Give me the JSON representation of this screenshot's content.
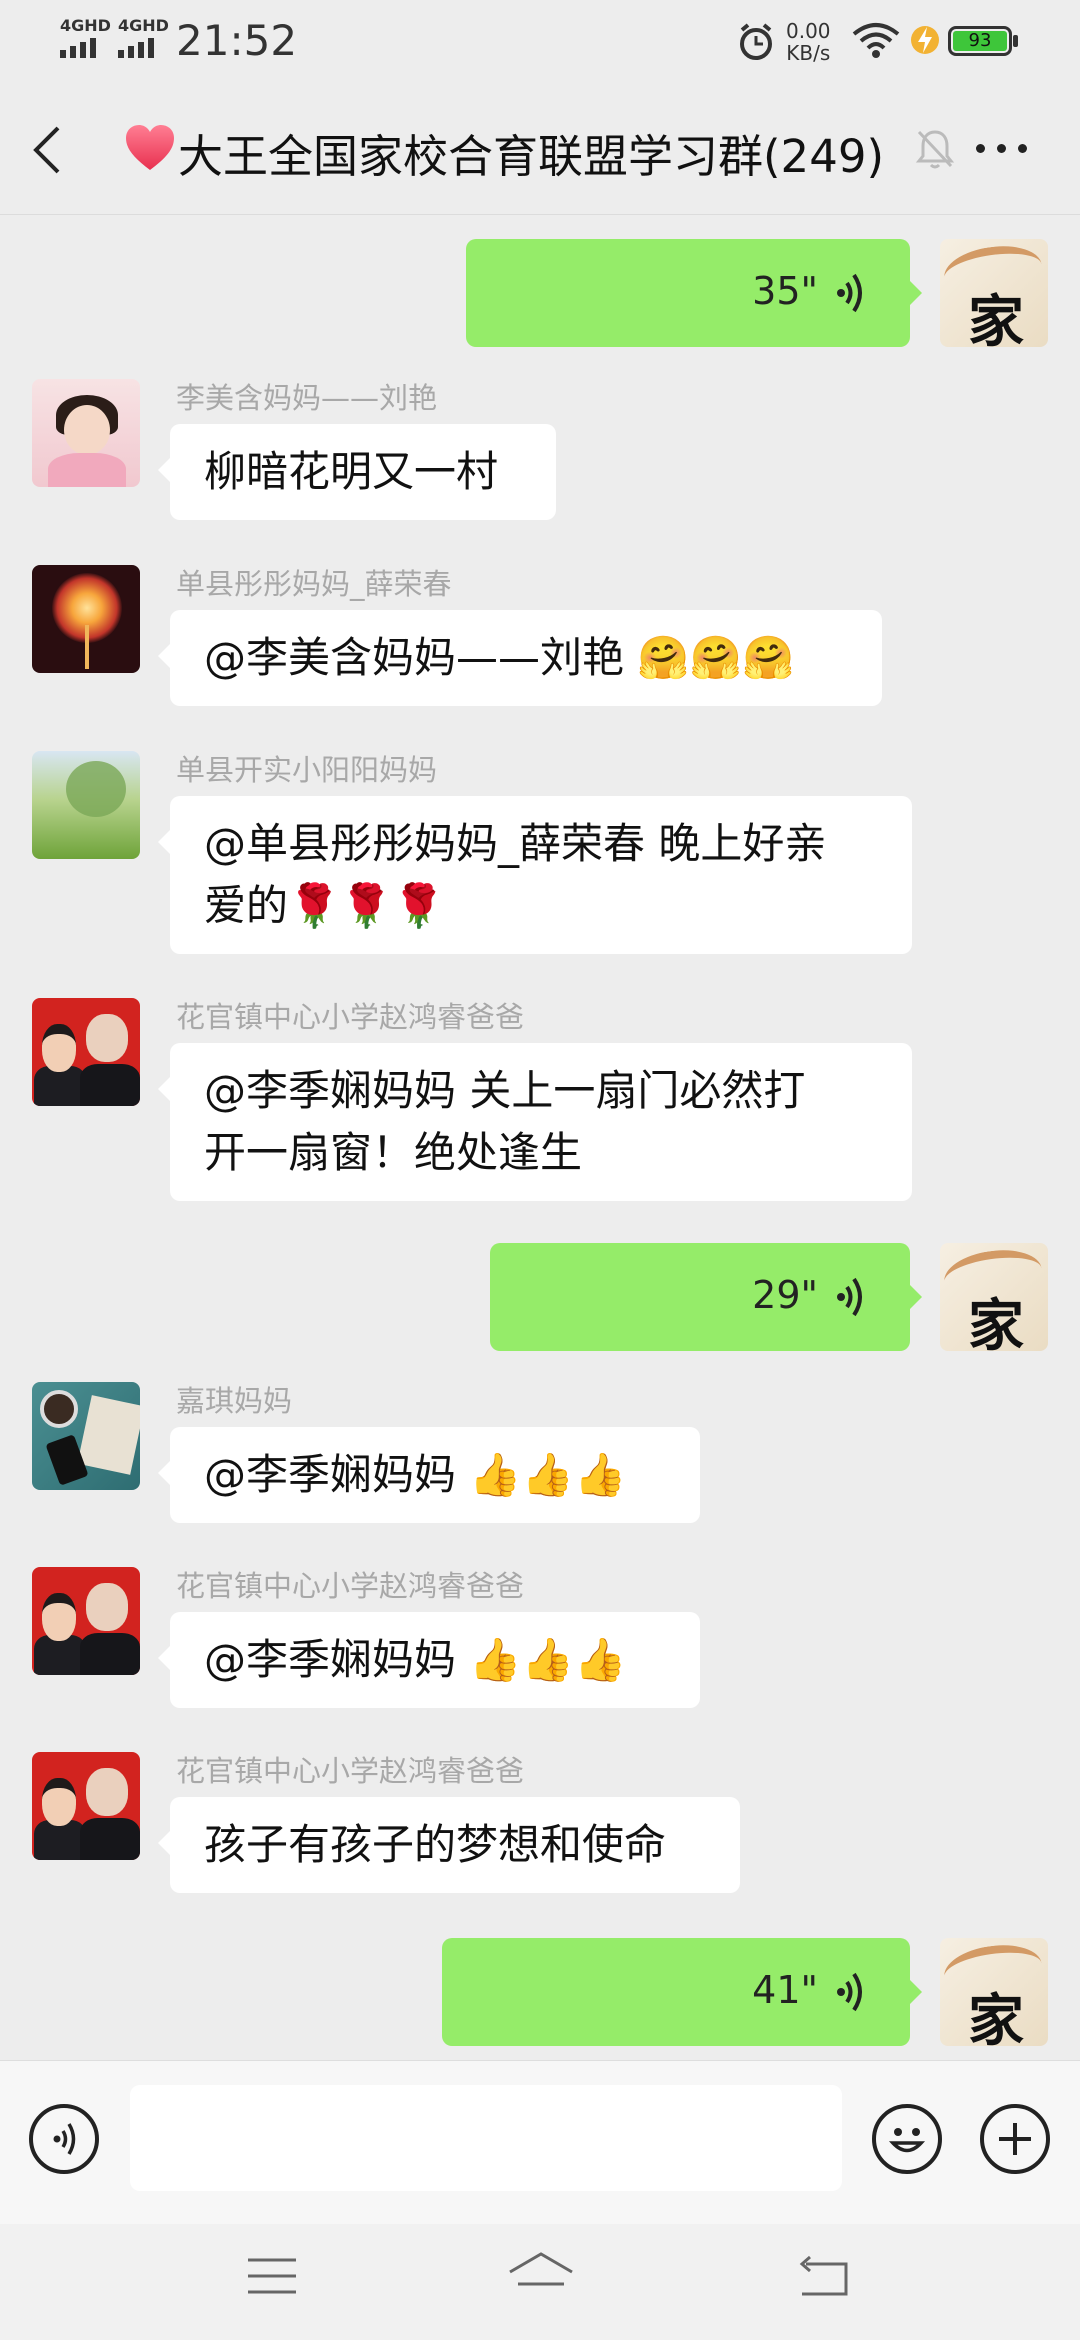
{
  "status_bar": {
    "signal1_label": "4GHD",
    "signal2_label": "4GHD",
    "time": "21:52",
    "net_speed_value": "0.00",
    "net_speed_unit": "KB/s",
    "battery_level": "93"
  },
  "header": {
    "title": "大王全国家校合育联盟学习群(249)",
    "title_emoji": "heart",
    "muted": true
  },
  "messages": [
    {
      "side": "right",
      "type": "voice",
      "duration": "35\""
    },
    {
      "side": "left",
      "sender": "李美含妈妈——刘艳",
      "text": "柳暗花明又一村"
    },
    {
      "side": "left",
      "sender": "单县彤彤妈妈_薛荣春",
      "text": "@李美含妈妈——刘艳  🤗🤗🤗"
    },
    {
      "side": "left",
      "sender": "单县开实小阳阳妈妈",
      "text_line1": "@单县彤彤妈妈_薛荣春  晚上好亲",
      "text_line2": "爱的🌹🌹🌹"
    },
    {
      "side": "left",
      "sender": "花官镇中心小学赵鸿睿爸爸",
      "text_line1": "@李季娴妈妈  关上一扇门必然打",
      "text_line2": "开一扇窗！绝处逢生"
    },
    {
      "side": "right",
      "type": "voice",
      "duration": "29\""
    },
    {
      "side": "left",
      "sender": "嘉琪妈妈",
      "text": "@李季娴妈妈 👍👍👍"
    },
    {
      "side": "left",
      "sender": "花官镇中心小学赵鸿睿爸爸",
      "text": "@李季娴妈妈 👍👍👍"
    },
    {
      "side": "left",
      "sender": "花官镇中心小学赵鸿睿爸爸",
      "text": "孩子有孩子的梦想和使命"
    },
    {
      "side": "right",
      "type": "voice",
      "duration": "41\""
    }
  ],
  "avatars": {
    "self_char": "家"
  },
  "input": {
    "value": "",
    "placeholder": ""
  },
  "icons": [
    "back-icon",
    "mute-icon",
    "more-icon",
    "voice-input-icon",
    "emoji-icon",
    "plus-icon",
    "menu-nav-icon",
    "home-nav-icon",
    "back-nav-icon"
  ],
  "colors": {
    "background": "#ededed",
    "voice_bubble": "#95ec69",
    "text_bubble": "#ffffff",
    "battery_fill": "#3ec63a",
    "sender_name": "#a8a8a8"
  }
}
